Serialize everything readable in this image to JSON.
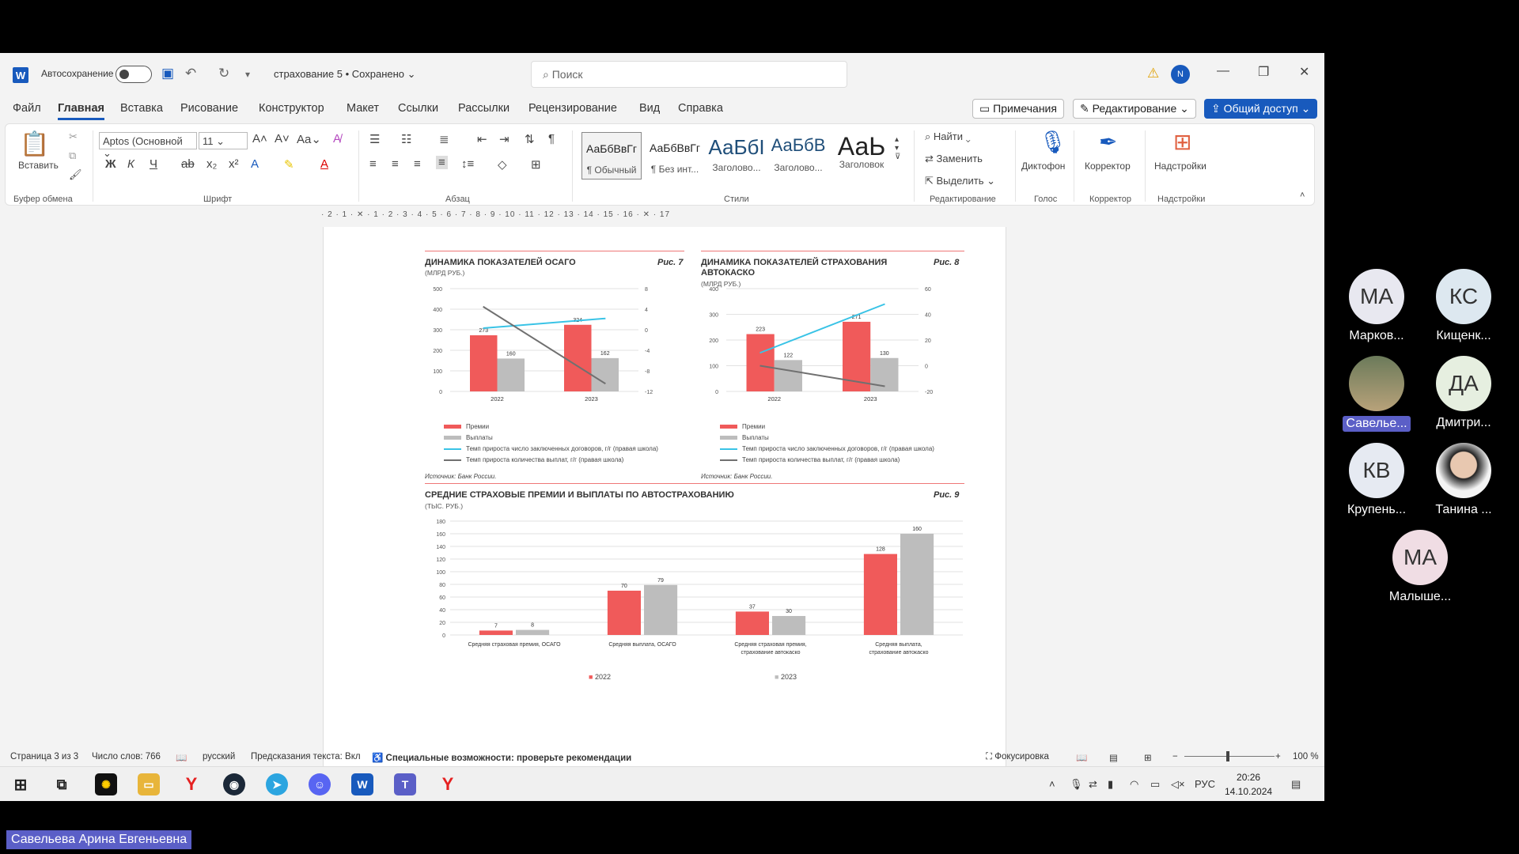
{
  "titlebar": {
    "autosave_label": "Автосохранение",
    "doc_name": "страхование 5 • Сохранено",
    "search_placeholder": "Поиск",
    "user_initial": "N"
  },
  "menu": {
    "items": [
      "Файл",
      "Главная",
      "Вставка",
      "Рисование",
      "Конструктор",
      "Макет",
      "Ссылки",
      "Рассылки",
      "Рецензирование",
      "Вид",
      "Справка"
    ],
    "comments": "Примечания",
    "editing": "Редактирование",
    "share": "Общий доступ"
  },
  "ribbon": {
    "paste": "Вставить",
    "font_name": "Aptos (Основной",
    "font_size": "11",
    "styles": [
      {
        "preview": "АаБбВвГг",
        "name": "¶ Обычный"
      },
      {
        "preview": "АаБбВвГг",
        "name": "¶ Без инт..."
      },
      {
        "preview": "АаБбІ",
        "name": "Заголово..."
      },
      {
        "preview": "АаБбВ",
        "name": "Заголово..."
      },
      {
        "preview": "АаЬ",
        "name": "Заголовок"
      }
    ],
    "find": "Найти",
    "replace": "Заменить",
    "select": "Выделить",
    "dictate": "Диктофон",
    "editor": "Корректор",
    "addins": "Надстройки",
    "groups": {
      "clipboard": "Буфер обмена",
      "font": "Шрифт",
      "paragraph": "Абзац",
      "styles": "Стили",
      "editing": "Редактирование",
      "voice": "Голос",
      "editor": "Корректор",
      "addins": "Надстройки"
    }
  },
  "ruler": "· 2 · 1 · ✕ · 1 · 2 · 3 · 4 · 5 · 6 · 7 · 8 · 9 · 10 · 11 · 12 · 13 · 14 · 15 · 16 · ✕ · 17",
  "figures": {
    "fig7": {
      "title": "ДИНАМИКА ПОКАЗАТЕЛЕЙ ОСАГО",
      "sub": "(МЛРД РУБ.)",
      "num": "Рис. 7"
    },
    "fig8": {
      "title": "ДИНАМИКА ПОКАЗАТЕЛЕЙ СТРАХОВАНИЯ АВТОКАСКО",
      "sub": "(МЛРД РУБ.)",
      "num": "Рис. 8"
    },
    "fig9": {
      "title": "СРЕДНИЕ СТРАХОВЫЕ ПРЕМИИ И ВЫПЛАТЫ ПО АВТОСТРАХОВАНИЮ",
      "sub": "(ТЫС. РУБ.)",
      "num": "Рис. 9"
    },
    "source": "Источник: Банк России.",
    "legend": [
      "Премии",
      "Выплаты",
      "Темп прироста число заключенных договоров, г/г (правая школа)",
      "Темп прироста количества выплат, г/г (правая школа)"
    ]
  },
  "chart_data": [
    {
      "type": "bar",
      "title": "ДИНАМИКА ПОКАЗАТЕЛЕЙ ОСАГО",
      "categories": [
        "2022",
        "2023"
      ],
      "series": [
        {
          "name": "Премии",
          "values": [
            273,
            324
          ],
          "color": "#f05a5a"
        },
        {
          "name": "Выплаты",
          "values": [
            160,
            162
          ],
          "color": "#bdbdbd"
        },
        {
          "name": "Темп прироста число заключенных договоров, г/г (правая школа)",
          "type": "line",
          "axis": "right",
          "values": [
            0.3,
            2.2
          ],
          "color": "#39c3e6"
        },
        {
          "name": "Темп прироста количества выплат, г/г (правая школа)",
          "type": "line",
          "axis": "right",
          "values": [
            4.5,
            -10.5
          ],
          "color": "#707070"
        }
      ],
      "ylim": [
        0,
        500
      ],
      "yticks": [
        0,
        100,
        200,
        300,
        400,
        500
      ],
      "y2lim": [
        -12,
        8
      ],
      "y2ticks": [
        -12,
        -8,
        -4,
        0,
        4,
        8
      ]
    },
    {
      "type": "bar",
      "title": "ДИНАМИКА ПОКАЗАТЕЛЕЙ СТРАХОВАНИЯ АВТОКАСКО",
      "categories": [
        "2022",
        "2023"
      ],
      "series": [
        {
          "name": "Премии",
          "values": [
            223,
            271
          ],
          "color": "#f05a5a"
        },
        {
          "name": "Выплаты",
          "values": [
            122,
            130
          ],
          "color": "#bdbdbd"
        },
        {
          "name": "Темп прироста число заключенных договоров, г/г (правая школа)",
          "type": "line",
          "axis": "right",
          "values": [
            10,
            48
          ],
          "color": "#39c3e6"
        },
        {
          "name": "Темп прироста количества выплат, г/г (правая школа)",
          "type": "line",
          "axis": "right",
          "values": [
            0,
            -16
          ],
          "color": "#707070"
        }
      ],
      "ylim": [
        0,
        400
      ],
      "yticks": [
        0,
        100,
        200,
        300,
        400
      ],
      "y2lim": [
        -20,
        60
      ],
      "y2ticks": [
        -20,
        0,
        20,
        40,
        60
      ]
    },
    {
      "type": "bar",
      "title": "СРЕДНИЕ СТРАХОВЫЕ ПРЕМИИ И ВЫПЛАТЫ ПО АВТОСТРАХОВАНИЮ",
      "categories": [
        "Средняя страховая премия, ОСАГО",
        "Средняя выплата, ОСАГО",
        "Средняя страховая премия, страхование автокаско",
        "Средняя выплата, страхование автокаско"
      ],
      "series": [
        {
          "name": "2022",
          "values": [
            7,
            70,
            37,
            128
          ],
          "color": "#f05a5a"
        },
        {
          "name": "2023",
          "values": [
            8,
            79,
            30,
            160
          ],
          "color": "#bdbdbd"
        }
      ],
      "ylim": [
        0,
        180
      ],
      "yticks": [
        0,
        20,
        40,
        60,
        80,
        100,
        120,
        140,
        160,
        180
      ]
    }
  ],
  "status": {
    "page": "Страница 3 из 3",
    "words": "Число слов: 766",
    "lang": "русский",
    "predict": "Предсказания текста: Вкл",
    "access": "Специальные возможности: проверьте рекомендации",
    "focus": "Фокусировка",
    "zoom": "100 %"
  },
  "taskbar": {
    "lang": "РУС",
    "time": "20:26",
    "date": "14.10.2024"
  },
  "participants": [
    {
      "initials": "МА",
      "name": "Марков...",
      "color": "#e8e8f0"
    },
    {
      "initials": "КС",
      "name": "Кищенк...",
      "color": "#dde8f0"
    },
    {
      "initials": "",
      "name": "Савелье...",
      "color": "#8a9a7a"
    },
    {
      "initials": "ДА",
      "name": "Дмитри...",
      "color": "#e6efe0"
    },
    {
      "initials": "КВ",
      "name": "Крупень...",
      "color": "#e6eaf2"
    },
    {
      "initials": "",
      "name": "Танина ...",
      "color": "#f2f2f2"
    },
    {
      "initials": "МА",
      "name": "Малыше...",
      "color": "#f0dde4"
    }
  ],
  "presenter": "Савельева Арина Евгеньевна"
}
